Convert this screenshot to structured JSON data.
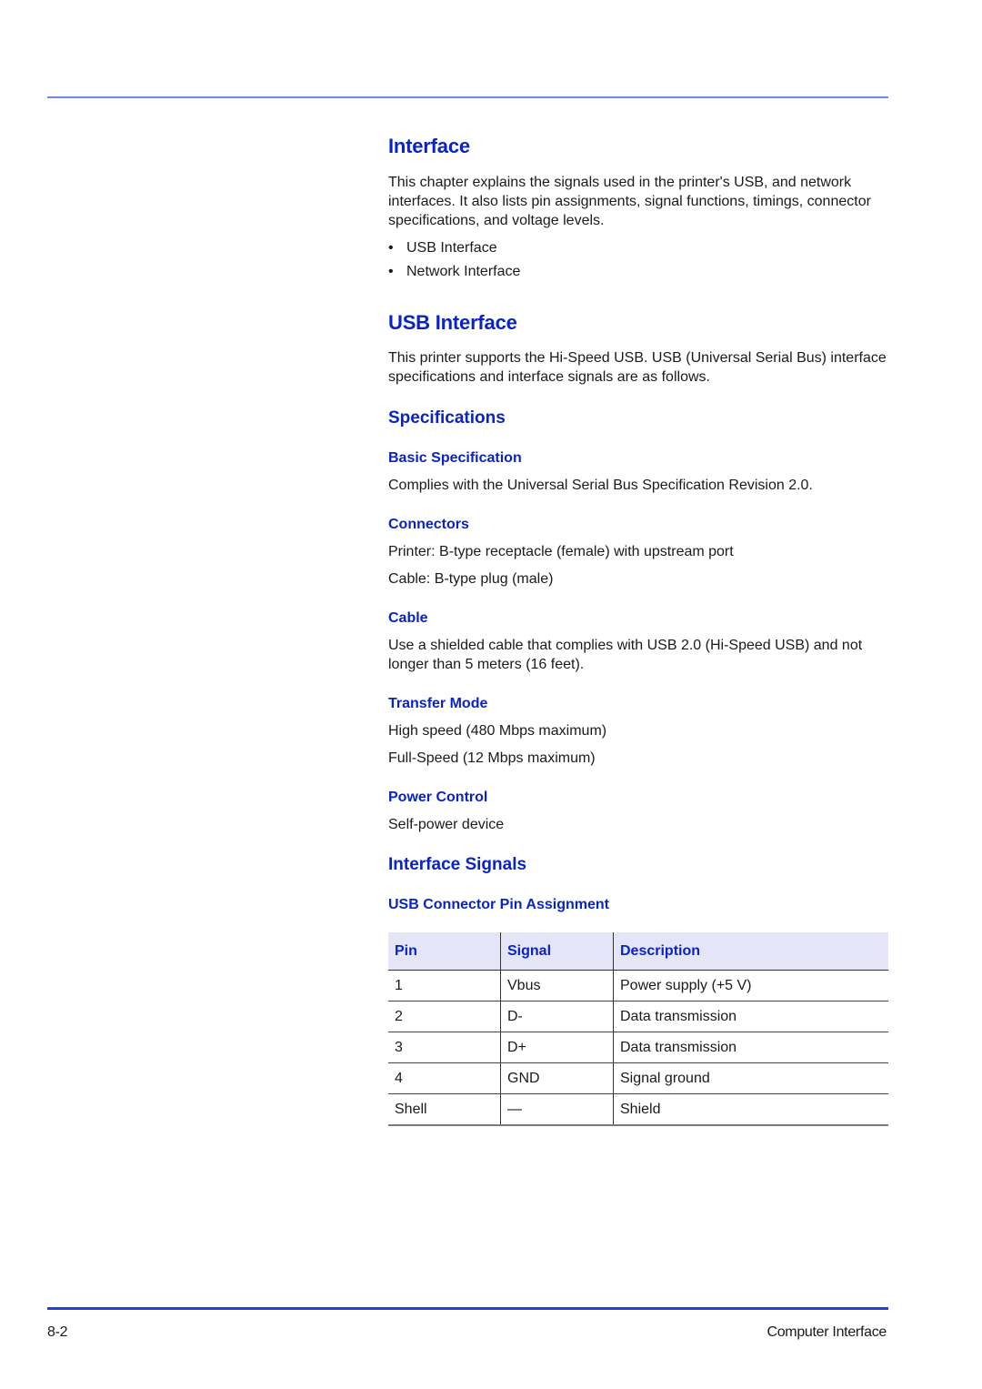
{
  "page": {
    "title": "Interface",
    "intro": "This chapter explains the signals used in the printer's USB, and network interfaces. It also lists pin assignments, signal functions, timings, connector specifications, and voltage levels.",
    "bullet_glyph": "•",
    "bullets": [
      "USB Interface",
      "Network Interface"
    ]
  },
  "usb": {
    "heading": "USB Interface",
    "intro": "This printer supports the Hi-Speed USB. USB (Universal Serial Bus) interface specifications and interface signals are as follows.",
    "specifications": {
      "heading": "Specifications",
      "basic": {
        "heading": "Basic Specification",
        "text": "Complies with the Universal Serial Bus Specification Revision 2.0."
      },
      "connectors": {
        "heading": "Connectors",
        "lines": [
          "Printer: B-type receptacle (female) with upstream port",
          "Cable: B-type plug (male)"
        ]
      },
      "cable": {
        "heading": "Cable",
        "text": "Use a shielded cable that complies with USB 2.0 (Hi-Speed USB) and not longer than 5 meters (16 feet)."
      },
      "transfer_mode": {
        "heading": "Transfer Mode",
        "lines": [
          "High speed (480 Mbps maximum)",
          "Full-Speed (12 Mbps maximum)"
        ]
      },
      "power_control": {
        "heading": "Power Control",
        "text": "Self-power device"
      }
    },
    "signals": {
      "heading": "Interface Signals",
      "pin_assignment": {
        "heading": "USB Connector Pin Assignment",
        "columns": [
          "Pin",
          "Signal",
          "Description"
        ],
        "rows": [
          [
            "1",
            "Vbus",
            "Power supply (+5 V)"
          ],
          [
            "2",
            "D-",
            "Data transmission"
          ],
          [
            "3",
            "D+",
            "Data transmission"
          ],
          [
            "4",
            "GND",
            "Signal ground"
          ],
          [
            "Shell",
            "—",
            "Shield"
          ]
        ]
      }
    }
  },
  "footer": {
    "page_number": "8-2",
    "chapter": "Computer Interface"
  },
  "colors": {
    "heading": "#0a24c4",
    "table_header_bg": "#e4e6f8",
    "top_rule": "#6f88e0",
    "bottom_rule": "#1f3fd6"
  }
}
